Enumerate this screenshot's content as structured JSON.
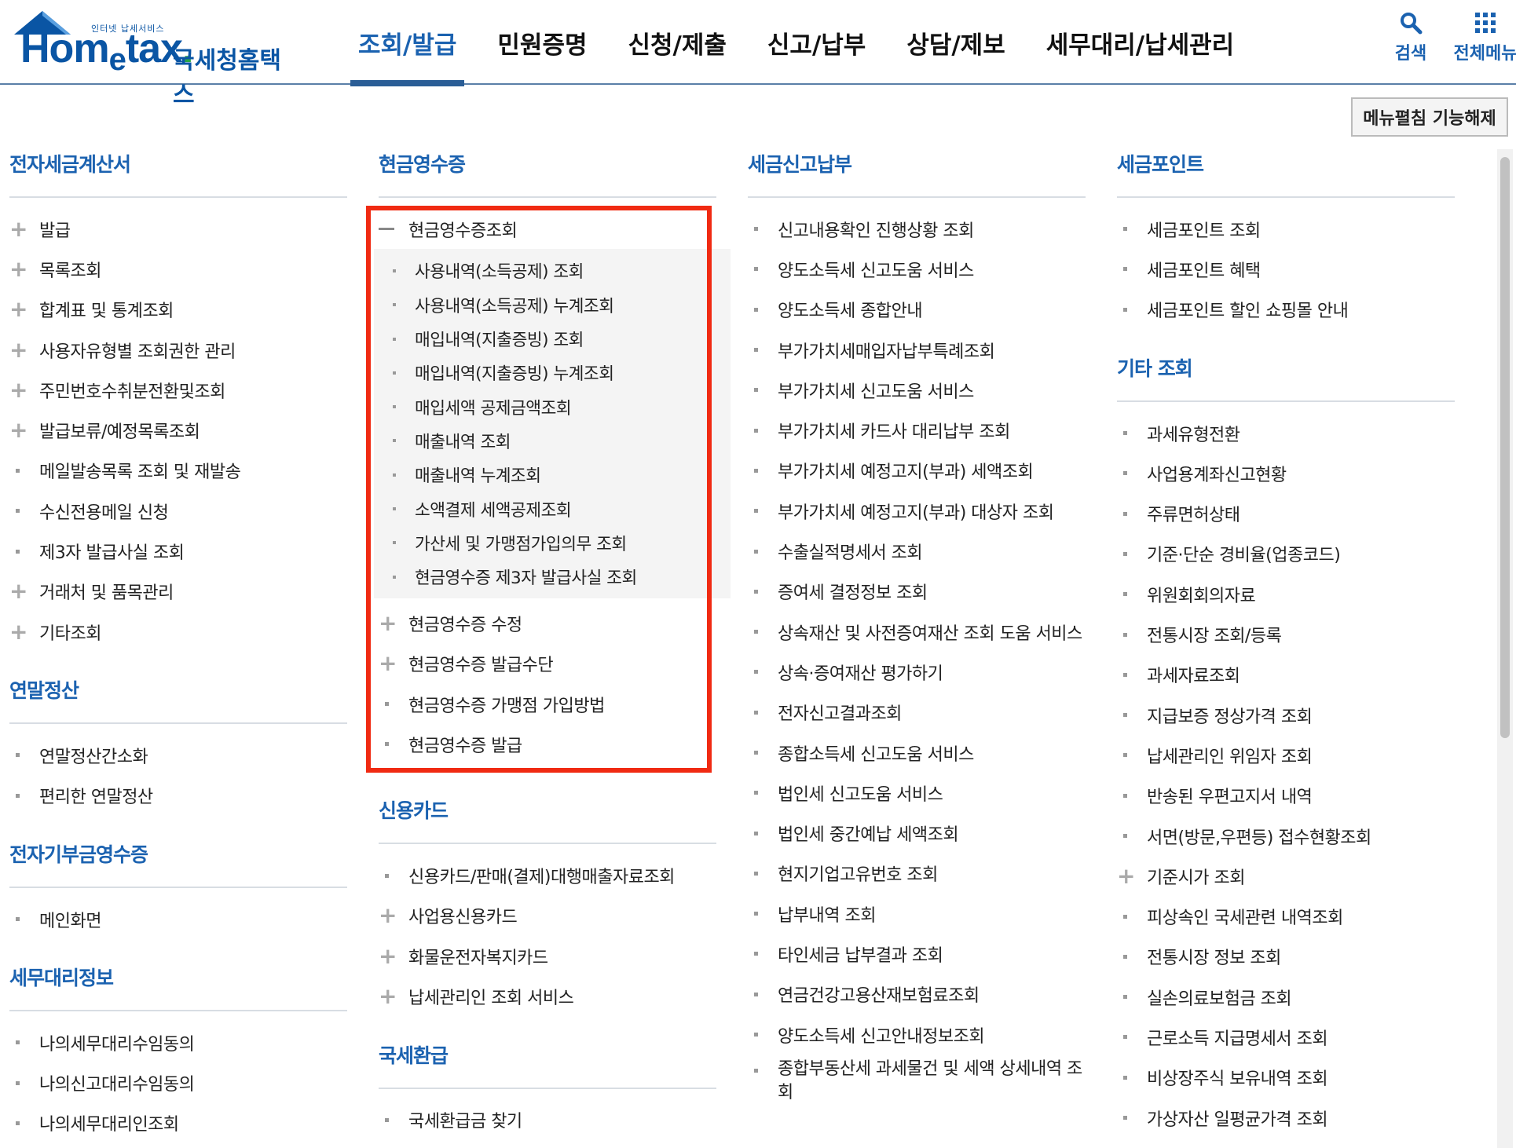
{
  "header": {
    "logo_small": "인터넷 납세서비스",
    "logo_main_a": "Hom",
    "logo_main_b": "e",
    "logo_main_c": "tax",
    "logo_dot": ".",
    "logo_sub": "국세청홈택스",
    "nav": [
      "조회/발급",
      "민원증명",
      "신청/제출",
      "신고/납부",
      "상담/제보",
      "세무대리/납세관리"
    ],
    "active_nav": "조회/발급",
    "search_label": "검색",
    "allmenu_label": "전체메뉴"
  },
  "unfold_button": "메뉴펼침 기능해제",
  "col1": {
    "sec1": {
      "title": "전자세금계산서",
      "items": [
        {
          "label": "발급",
          "marker": "plus"
        },
        {
          "label": "목록조회",
          "marker": "plus"
        },
        {
          "label": "합계표 및 통계조회",
          "marker": "plus"
        },
        {
          "label": "사용자유형별 조회권한 관리",
          "marker": "plus"
        },
        {
          "label": "주민번호수취분전환및조회",
          "marker": "plus"
        },
        {
          "label": "발급보류/예정목록조회",
          "marker": "plus"
        },
        {
          "label": "메일발송목록 조회 및 재발송",
          "marker": "dot"
        },
        {
          "label": "수신전용메일 신청",
          "marker": "dot"
        },
        {
          "label": "제3자 발급사실 조회",
          "marker": "dot"
        },
        {
          "label": "거래처 및 품목관리",
          "marker": "plus"
        },
        {
          "label": "기타조회",
          "marker": "plus"
        }
      ]
    },
    "sec2": {
      "title": "연말정산",
      "items": [
        {
          "label": "연말정산간소화",
          "marker": "dot"
        },
        {
          "label": "편리한 연말정산",
          "marker": "dot"
        }
      ]
    },
    "sec3": {
      "title": "전자기부금영수증",
      "items": [
        {
          "label": "메인화면",
          "marker": "dot"
        }
      ]
    },
    "sec4": {
      "title": "세무대리정보",
      "items": [
        {
          "label": "나의세무대리수임동의",
          "marker": "dot"
        },
        {
          "label": "나의신고대리수임동의",
          "marker": "dot"
        },
        {
          "label": "나의세무대리인조회",
          "marker": "dot"
        }
      ]
    }
  },
  "col2": {
    "sec1": {
      "title": "현금영수증",
      "expanded": "현금영수증조회",
      "sub_items": [
        "사용내역(소득공제) 조회",
        "사용내역(소득공제) 누계조회",
        "매입내역(지출증빙) 조회",
        "매입내역(지출증빙) 누계조회",
        "매입세액 공제금액조회",
        "매출내역 조회",
        "매출내역 누계조회",
        "소액결제 세액공제조회",
        "가산세 및 가맹점가입의무 조회",
        "현금영수증 제3자 발급사실 조회"
      ],
      "items": [
        {
          "label": "현금영수증 수정",
          "marker": "plus"
        },
        {
          "label": "현금영수증 발급수단",
          "marker": "plus"
        },
        {
          "label": "현금영수증 가맹점 가입방법",
          "marker": "dot"
        },
        {
          "label": "현금영수증 발급",
          "marker": "dot"
        }
      ]
    },
    "sec2": {
      "title": "신용카드",
      "items": [
        {
          "label": "신용카드/판매(결제)대행매출자료조회",
          "marker": "dot"
        },
        {
          "label": "사업용신용카드",
          "marker": "plus"
        },
        {
          "label": "화물운전자복지카드",
          "marker": "plus"
        },
        {
          "label": "납세관리인 조회 서비스",
          "marker": "plus"
        }
      ]
    },
    "sec3": {
      "title": "국세환급",
      "items": [
        {
          "label": "국세환급금 찾기",
          "marker": "dot"
        }
      ]
    }
  },
  "col3": {
    "sec1": {
      "title": "세금신고납부",
      "items": [
        {
          "label": "신고내용확인 진행상황 조회",
          "marker": "dot"
        },
        {
          "label": "양도소득세 신고도움 서비스",
          "marker": "dot"
        },
        {
          "label": "양도소득세 종합안내",
          "marker": "dot"
        },
        {
          "label": "부가가치세매입자납부특례조회",
          "marker": "dot"
        },
        {
          "label": "부가가치세 신고도움 서비스",
          "marker": "dot"
        },
        {
          "label": "부가가치세 카드사 대리납부 조회",
          "marker": "dot"
        },
        {
          "label": "부가가치세 예정고지(부과) 세액조회",
          "marker": "dot"
        },
        {
          "label": "부가가치세 예정고지(부과) 대상자 조회",
          "marker": "dot"
        },
        {
          "label": "수출실적명세서 조회",
          "marker": "dot"
        },
        {
          "label": "증여세 결정정보 조회",
          "marker": "dot"
        },
        {
          "label": "상속재산 및 사전증여재산 조회 도움 서비스",
          "marker": "dot"
        },
        {
          "label": "상속·증여재산 평가하기",
          "marker": "dot"
        },
        {
          "label": "전자신고결과조회",
          "marker": "dot"
        },
        {
          "label": "종합소득세 신고도움 서비스",
          "marker": "dot"
        },
        {
          "label": "법인세 신고도움 서비스",
          "marker": "dot"
        },
        {
          "label": "법인세 중간예납 세액조회",
          "marker": "dot"
        },
        {
          "label": "현지기업고유번호 조회",
          "marker": "dot"
        },
        {
          "label": "납부내역 조회",
          "marker": "dot"
        },
        {
          "label": "타인세금 납부결과 조회",
          "marker": "dot"
        },
        {
          "label": "연금건강고용산재보험료조회",
          "marker": "dot"
        },
        {
          "label": "양도소득세 신고안내정보조회",
          "marker": "dot"
        }
      ],
      "wrap_item": "종합부동산세 과세물건 및 세액 상세내역 조회"
    }
  },
  "col4": {
    "sec1": {
      "title": "세금포인트",
      "items": [
        {
          "label": "세금포인트 조회",
          "marker": "dot"
        },
        {
          "label": "세금포인트 혜택",
          "marker": "dot"
        },
        {
          "label": "세금포인트 할인 쇼핑몰 안내",
          "marker": "dot"
        }
      ]
    },
    "sec2": {
      "title": "기타 조회",
      "items": [
        {
          "label": "과세유형전환",
          "marker": "dot"
        },
        {
          "label": "사업용계좌신고현황",
          "marker": "dot"
        },
        {
          "label": "주류면허상태",
          "marker": "dot"
        },
        {
          "label": "기준·단순 경비율(업종코드)",
          "marker": "dot"
        },
        {
          "label": "위원회회의자료",
          "marker": "dot"
        },
        {
          "label": "전통시장 조회/등록",
          "marker": "dot"
        },
        {
          "label": "과세자료조회",
          "marker": "dot"
        },
        {
          "label": "지급보증 정상가격 조회",
          "marker": "dot"
        },
        {
          "label": "납세관리인 위임자 조회",
          "marker": "dot"
        },
        {
          "label": "반송된 우편고지서 내역",
          "marker": "dot"
        },
        {
          "label": "서면(방문,우편등) 접수현황조회",
          "marker": "dot"
        },
        {
          "label": "기준시가 조회",
          "marker": "plus"
        },
        {
          "label": "피상속인 국세관련 내역조회",
          "marker": "dot"
        },
        {
          "label": "전통시장 정보 조회",
          "marker": "dot"
        },
        {
          "label": "실손의료보험금 조회",
          "marker": "dot"
        },
        {
          "label": "근로소득 지급명세서 조회",
          "marker": "dot"
        },
        {
          "label": "비상장주식 보유내역 조회",
          "marker": "dot"
        },
        {
          "label": "가상자산 일평균가격 조회",
          "marker": "dot"
        }
      ]
    }
  },
  "colors": {
    "brand_blue": "#1b62b0",
    "highlight_red": "#f02a12",
    "nav_underline": "#2a5d96"
  }
}
